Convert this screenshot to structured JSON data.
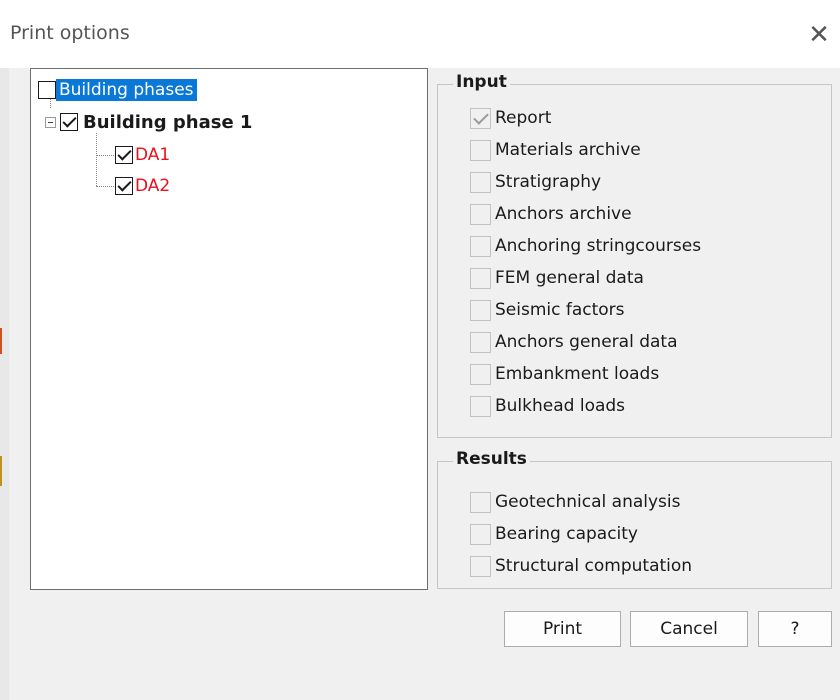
{
  "window": {
    "title": "Print options",
    "close_icon": "close-icon"
  },
  "tree": {
    "root": {
      "label": "Building phases",
      "checked": false,
      "selected": true
    },
    "phase": {
      "label": "Building phase 1",
      "checked": true
    },
    "children": [
      {
        "label": "DA1",
        "checked": true
      },
      {
        "label": "DA2",
        "checked": true
      }
    ]
  },
  "input_group": {
    "title": "Input",
    "options": [
      {
        "label": "Report",
        "checked": true
      },
      {
        "label": "Materials archive",
        "checked": false
      },
      {
        "label": "Stratigraphy",
        "checked": false
      },
      {
        "label": "Anchors archive",
        "checked": false
      },
      {
        "label": "Anchoring stringcourses",
        "checked": false
      },
      {
        "label": "FEM general data",
        "checked": false
      },
      {
        "label": "Seismic factors",
        "checked": false
      },
      {
        "label": "Anchors general data",
        "checked": false
      },
      {
        "label": "Embankment loads",
        "checked": false
      },
      {
        "label": "Bulkhead loads",
        "checked": false
      }
    ]
  },
  "results_group": {
    "title": "Results",
    "options": [
      {
        "label": "Geotechnical analysis",
        "checked": false
      },
      {
        "label": "Bearing capacity",
        "checked": false
      },
      {
        "label": "Structural computation",
        "checked": false
      }
    ]
  },
  "buttons": {
    "print": "Print",
    "cancel": "Cancel",
    "help": "?"
  },
  "colors": {
    "selection": "#0a78d7",
    "red_text": "#e8101c",
    "background": "#f0f0f0"
  }
}
